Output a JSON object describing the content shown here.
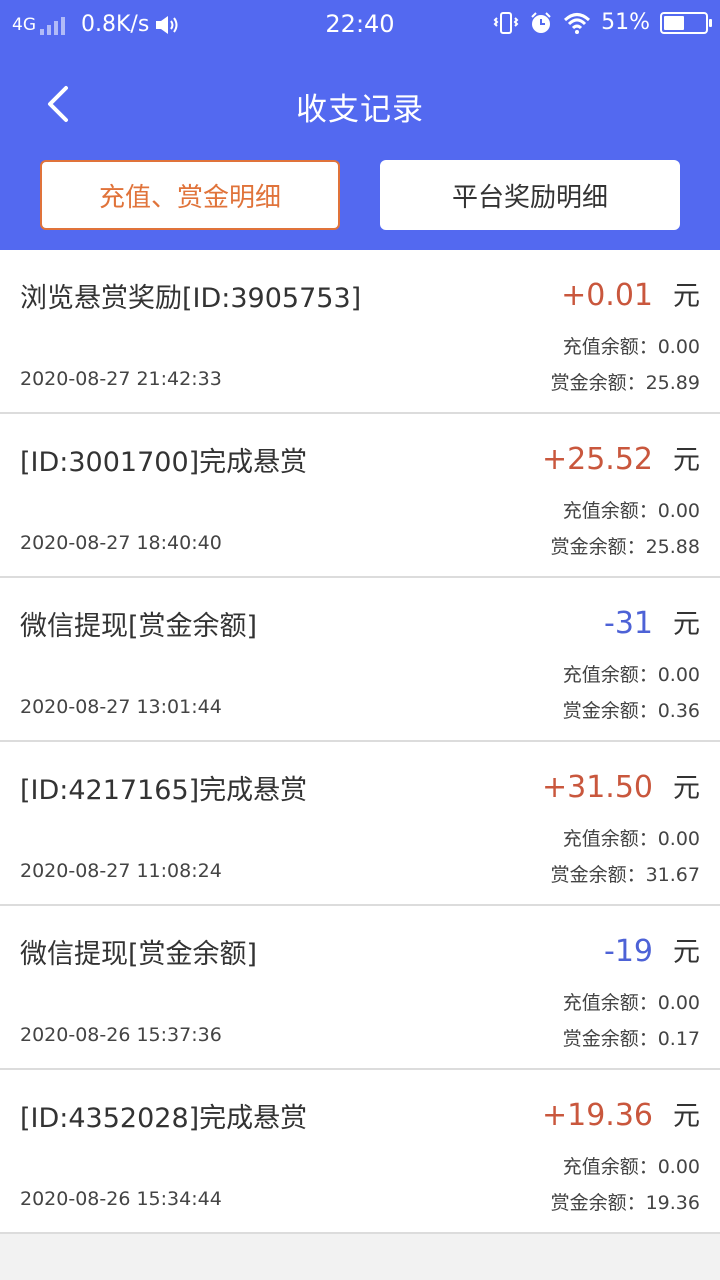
{
  "status_bar": {
    "network": "4G",
    "speed": "0.8K/s",
    "time": "22:40",
    "battery_percent": "51%",
    "battery_level": 0.51
  },
  "nav": {
    "title": "收支记录",
    "back_icon": "chevron-left-icon"
  },
  "tabs": [
    {
      "label": "充值、赏金明细",
      "active": true
    },
    {
      "label": "平台奖励明细",
      "active": false
    }
  ],
  "currency_unit": "元",
  "records": [
    {
      "title": "浏览悬赏奖励[ID:3905753]",
      "amount": "+0.01",
      "sign": "pos",
      "date": "2020-08-27 21:42:33",
      "recharge_balance": "充值余额：0.00",
      "bounty_balance": "赏金余额：25.89"
    },
    {
      "title": "[ID:3001700]完成悬赏",
      "amount": "+25.52",
      "sign": "pos",
      "date": "2020-08-27 18:40:40",
      "recharge_balance": "充值余额：0.00",
      "bounty_balance": "赏金余额：25.88"
    },
    {
      "title": "微信提现[赏金余额]",
      "amount": "-31",
      "sign": "neg",
      "date": "2020-08-27 13:01:44",
      "recharge_balance": "充值余额：0.00",
      "bounty_balance": "赏金余额：0.36"
    },
    {
      "title": "[ID:4217165]完成悬赏",
      "amount": "+31.50",
      "sign": "pos",
      "date": "2020-08-27 11:08:24",
      "recharge_balance": "充值余额：0.00",
      "bounty_balance": "赏金余额：31.67"
    },
    {
      "title": "微信提现[赏金余额]",
      "amount": "-19",
      "sign": "neg",
      "date": "2020-08-26 15:37:36",
      "recharge_balance": "充值余额：0.00",
      "bounty_balance": "赏金余额：0.17"
    },
    {
      "title": "[ID:4352028]完成悬赏",
      "amount": "+19.36",
      "sign": "pos",
      "date": "2020-08-26 15:34:44",
      "recharge_balance": "充值余额：0.00",
      "bounty_balance": "赏金余额：19.36"
    }
  ],
  "colors": {
    "header": "#5369f0",
    "active_tab": "#e0733a",
    "positive": "#c9573d",
    "negative": "#4d62d6"
  }
}
